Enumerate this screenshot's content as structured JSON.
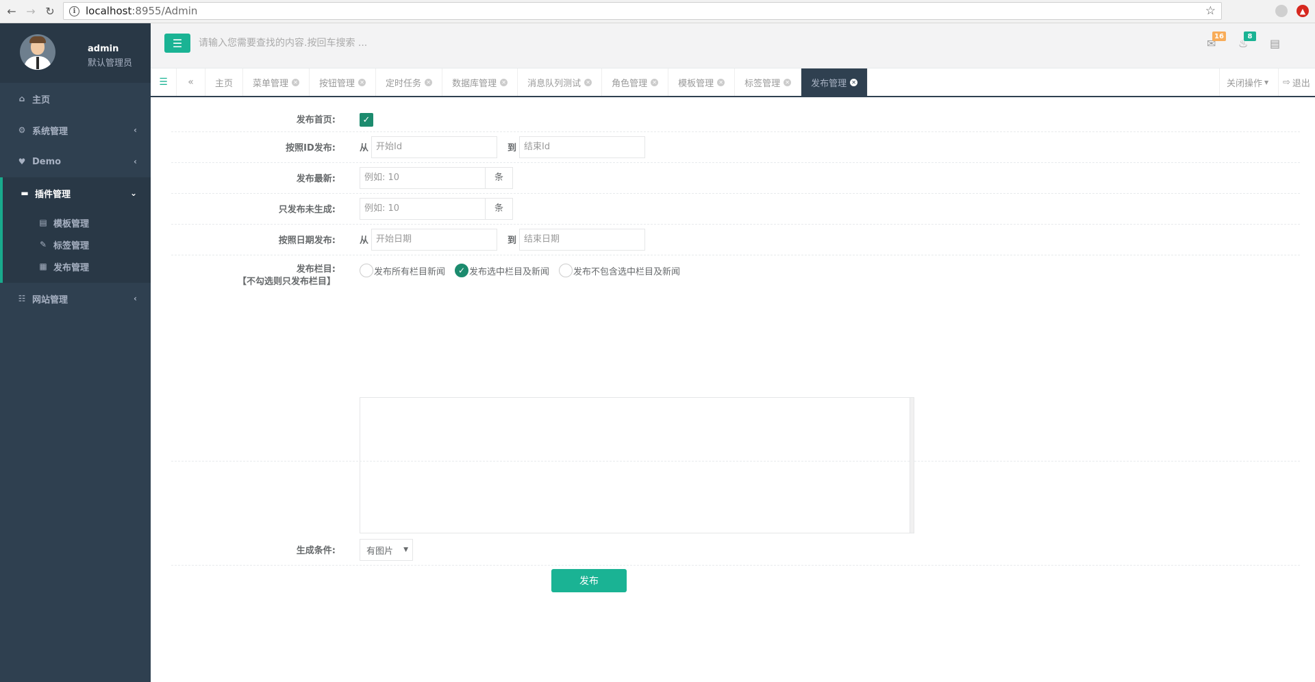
{
  "browser": {
    "url_host": "localhost",
    "url_path": ":8955/Admin"
  },
  "sidebar": {
    "user_name": "admin",
    "user_role": "默认管理员",
    "items": [
      {
        "label": "主页"
      },
      {
        "label": "系统管理"
      },
      {
        "label": "Demo"
      },
      {
        "label": "插件管理"
      },
      {
        "label": "网站管理"
      }
    ],
    "subitems": [
      {
        "label": "模板管理"
      },
      {
        "label": "标签管理"
      },
      {
        "label": "发布管理"
      }
    ]
  },
  "topbar": {
    "search_placeholder": "请输入您需要查找的内容.按回车搜索 ...",
    "mail_count": "16",
    "notice_count": "8"
  },
  "tabs": {
    "items": [
      {
        "label": "主页"
      },
      {
        "label": "菜单管理"
      },
      {
        "label": "按钮管理"
      },
      {
        "label": "定时任务"
      },
      {
        "label": "数据库管理"
      },
      {
        "label": "消息队列测试"
      },
      {
        "label": "角色管理"
      },
      {
        "label": "模板管理"
      },
      {
        "label": "标签管理"
      },
      {
        "label": "发布管理"
      }
    ],
    "close_ops": "关闭操作",
    "logout": "退出"
  },
  "form": {
    "home_label": "发布首页:",
    "id_label": "按照ID发布:",
    "from": "从",
    "to": "到",
    "start_id_placeholder": "开始Id",
    "end_id_placeholder": "结束Id",
    "latest_label": "发布最新:",
    "latest_placeholder": "例如: 10",
    "unit": "条",
    "ungenerated_label": "只发布未生成:",
    "ungenerated_placeholder": "例如: 10",
    "date_label": "按照日期发布:",
    "start_date_placeholder": "开始日期",
    "end_date_placeholder": "结束日期",
    "column_label": "发布栏目:",
    "column_hint": "【不勾选则只发布栏目】",
    "radio_all": "发布所有栏目新闻",
    "radio_selected": "发布选中栏目及新闻",
    "radio_exclude": "发布不包含选中栏目及新闻",
    "condition_label": "生成条件:",
    "condition_value": "有图片",
    "publish_button": "发布"
  }
}
